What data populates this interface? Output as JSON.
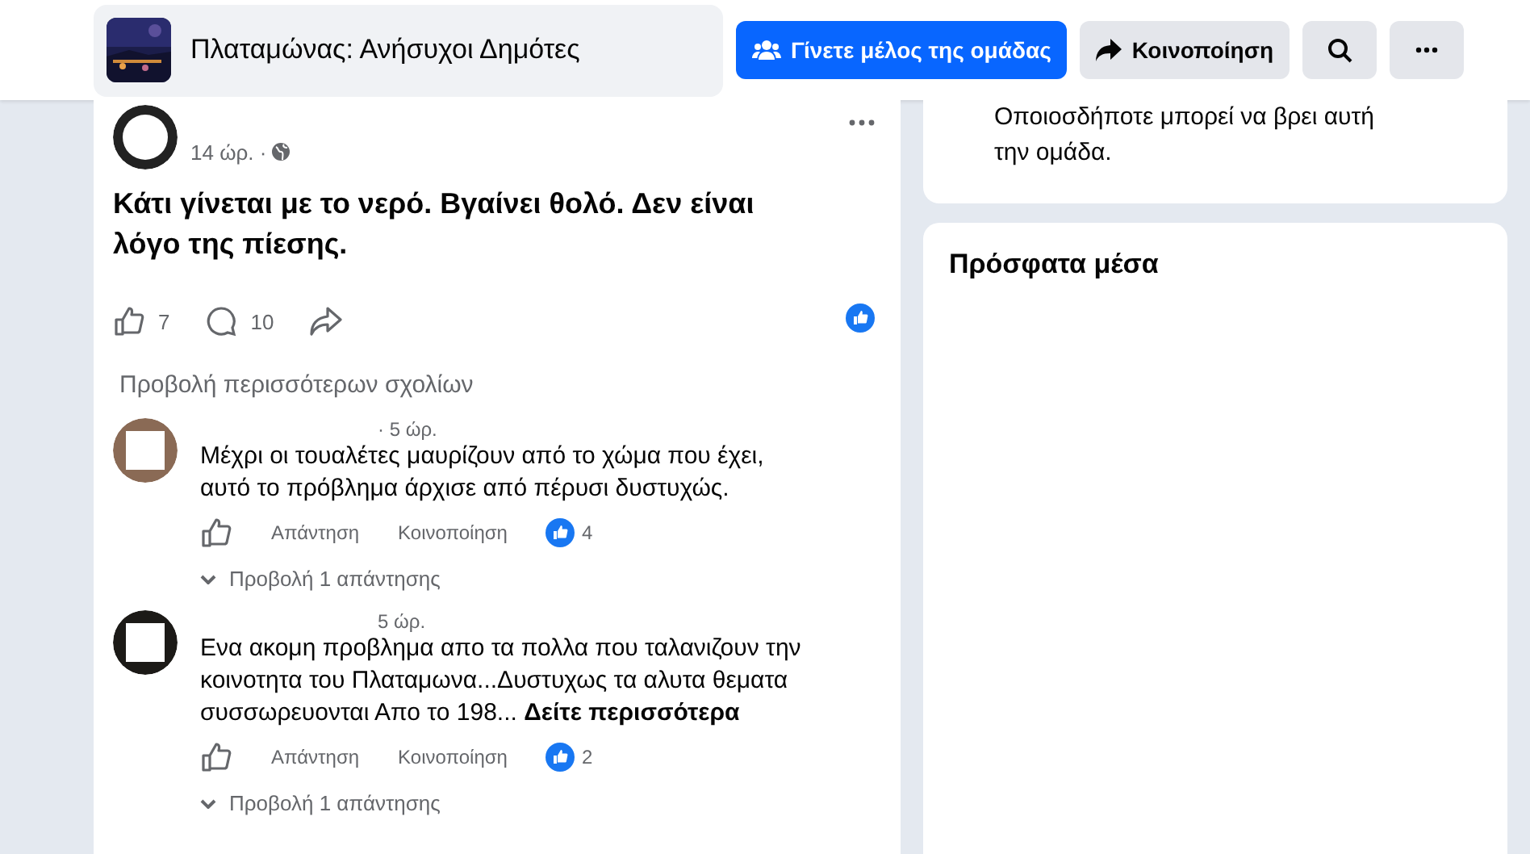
{
  "header": {
    "group_name": "Πλαταμώνας: Ανήσυχοι Δημότες",
    "join_button": "Γίνετε μέλος της ομάδας",
    "share_button": "Κοινοποίηση"
  },
  "post": {
    "time": "14 ώρ. ·",
    "text": "Κάτι γίνεται με το νερό. Βγαίνει θολό. Δεν είναι λόγο της πίεσης.",
    "likes": "7",
    "comments": "10",
    "more_comments": "Προβολή περισσότερων σχολίων"
  },
  "comments": [
    {
      "time": "· 5 ώρ.",
      "text": "Μέχρι οι τουαλέτες μαυρίζουν από το χώμα που έχει, αυτό το πρόβλημα άρχισε από πέρυσι δυστυχώς.",
      "reply": "Απάντηση",
      "share": "Κοινοποίηση",
      "reactions": "4",
      "replies": "Προβολή 1 απάντησης"
    },
    {
      "time": "5 ώρ.",
      "text": "Ενα ακομη προβλημα απο τα πολλα που ταλανιζουν την κοινοτητα του Πλαταμωνα...Δυστυχως τα αλυτα θεματα συσσωρευονται Απο το 198...",
      "see_more": "Δείτε περισσότερα",
      "reply": "Απάντηση",
      "share": "Κοινοποίηση",
      "reactions": "2",
      "replies": "Προβολή 1 απάντησης"
    }
  ],
  "sidebar": {
    "privacy_text": "Οποιοσδήποτε μπορεί να βρει αυτή την ομάδα.",
    "media_title": "Πρόσφατα μέσα"
  }
}
